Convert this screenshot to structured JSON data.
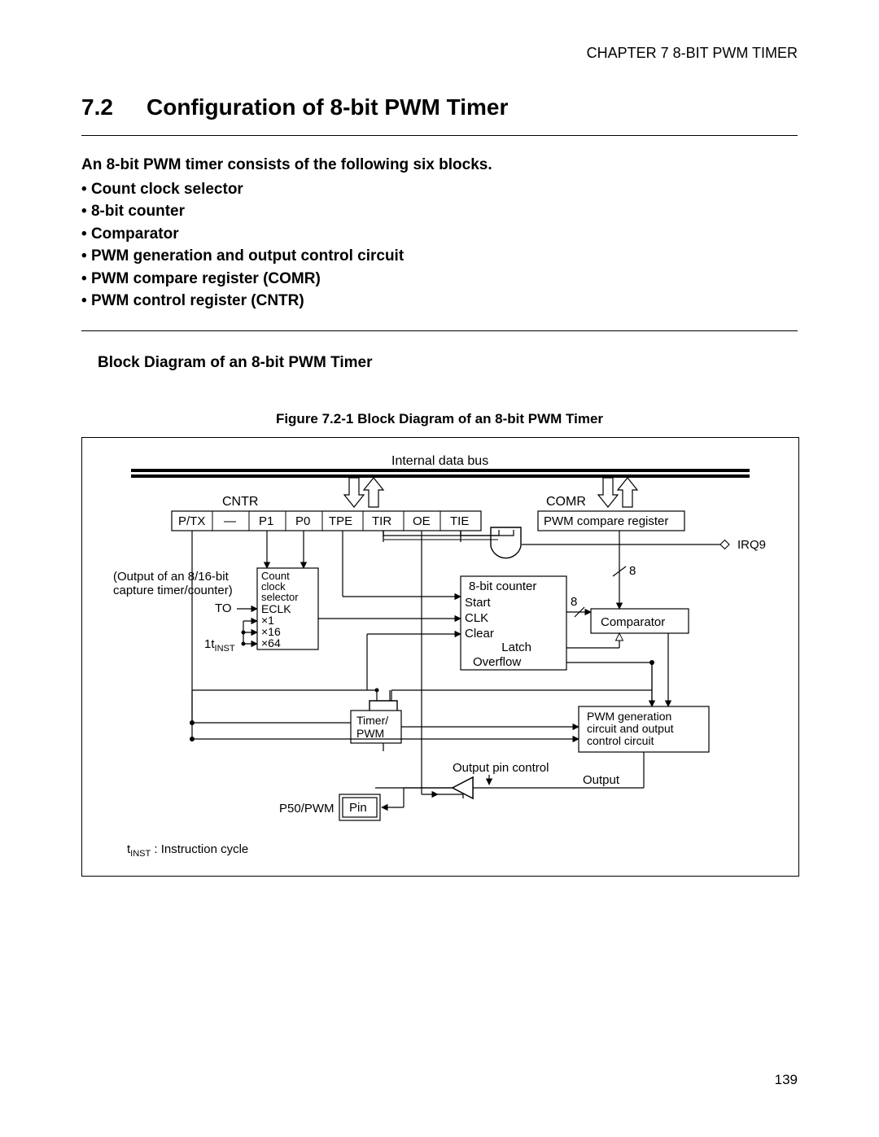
{
  "header": {
    "chapter": "CHAPTER 7  8-BIT PWM TIMER"
  },
  "section": {
    "number": "7.2",
    "title": "Configuration of 8-bit PWM Timer"
  },
  "intro": {
    "lead": "An 8-bit PWM timer consists of the following six blocks.",
    "items": [
      "Count clock selector",
      "8-bit counter",
      "Comparator",
      "PWM generation and output control circuit",
      "PWM compare register (COMR)",
      "PWM control register (CNTR)"
    ]
  },
  "subheading": "Block Diagram of an 8-bit PWM Timer",
  "figure": {
    "caption": "Figure 7.2-1  Block Diagram of an 8-bit PWM Timer"
  },
  "diagram": {
    "bus_label": "Internal data bus",
    "cntr_label": "CNTR",
    "comr_label": "COMR",
    "reg_fields": [
      "P/TX",
      "—",
      "P1",
      "P0",
      "TPE",
      "TIR",
      "OE",
      "TIE"
    ],
    "comr_box": "PWM compare register",
    "irq": "IRQ9",
    "capture_note1": "(Output of an 8/16-bit",
    "capture_note2": "capture timer/counter)",
    "to_label": "TO",
    "inst_left_coef": "1t",
    "inst_left_sub": "INST",
    "ccs_label1": "Count",
    "ccs_label2": "clock",
    "ccs_label3": "selector",
    "eclk": "ECLK",
    "x1": "×1",
    "x16": "×16",
    "x64": "×64",
    "counter_title": "8-bit counter",
    "counter_start": "Start",
    "counter_clk": "CLK",
    "counter_clear": "Clear",
    "counter_latch": "Latch",
    "counter_overflow": "Overflow",
    "bus8a": "8",
    "bus8b": "8",
    "comparator": "Comparator",
    "timer_pwm1": "Timer/",
    "timer_pwm2": "PWM",
    "pwm_gen1": "PWM generation",
    "pwm_gen2": "circuit and output",
    "pwm_gen3": "control circuit",
    "output_pin_ctrl": "Output pin control",
    "output_label": "Output",
    "p50": "P50/PWM",
    "pin": "Pin",
    "footnote_t": "t",
    "footnote_sub": "INST",
    "footnote_rest": " :  Instruction cycle"
  },
  "page_number": "139"
}
